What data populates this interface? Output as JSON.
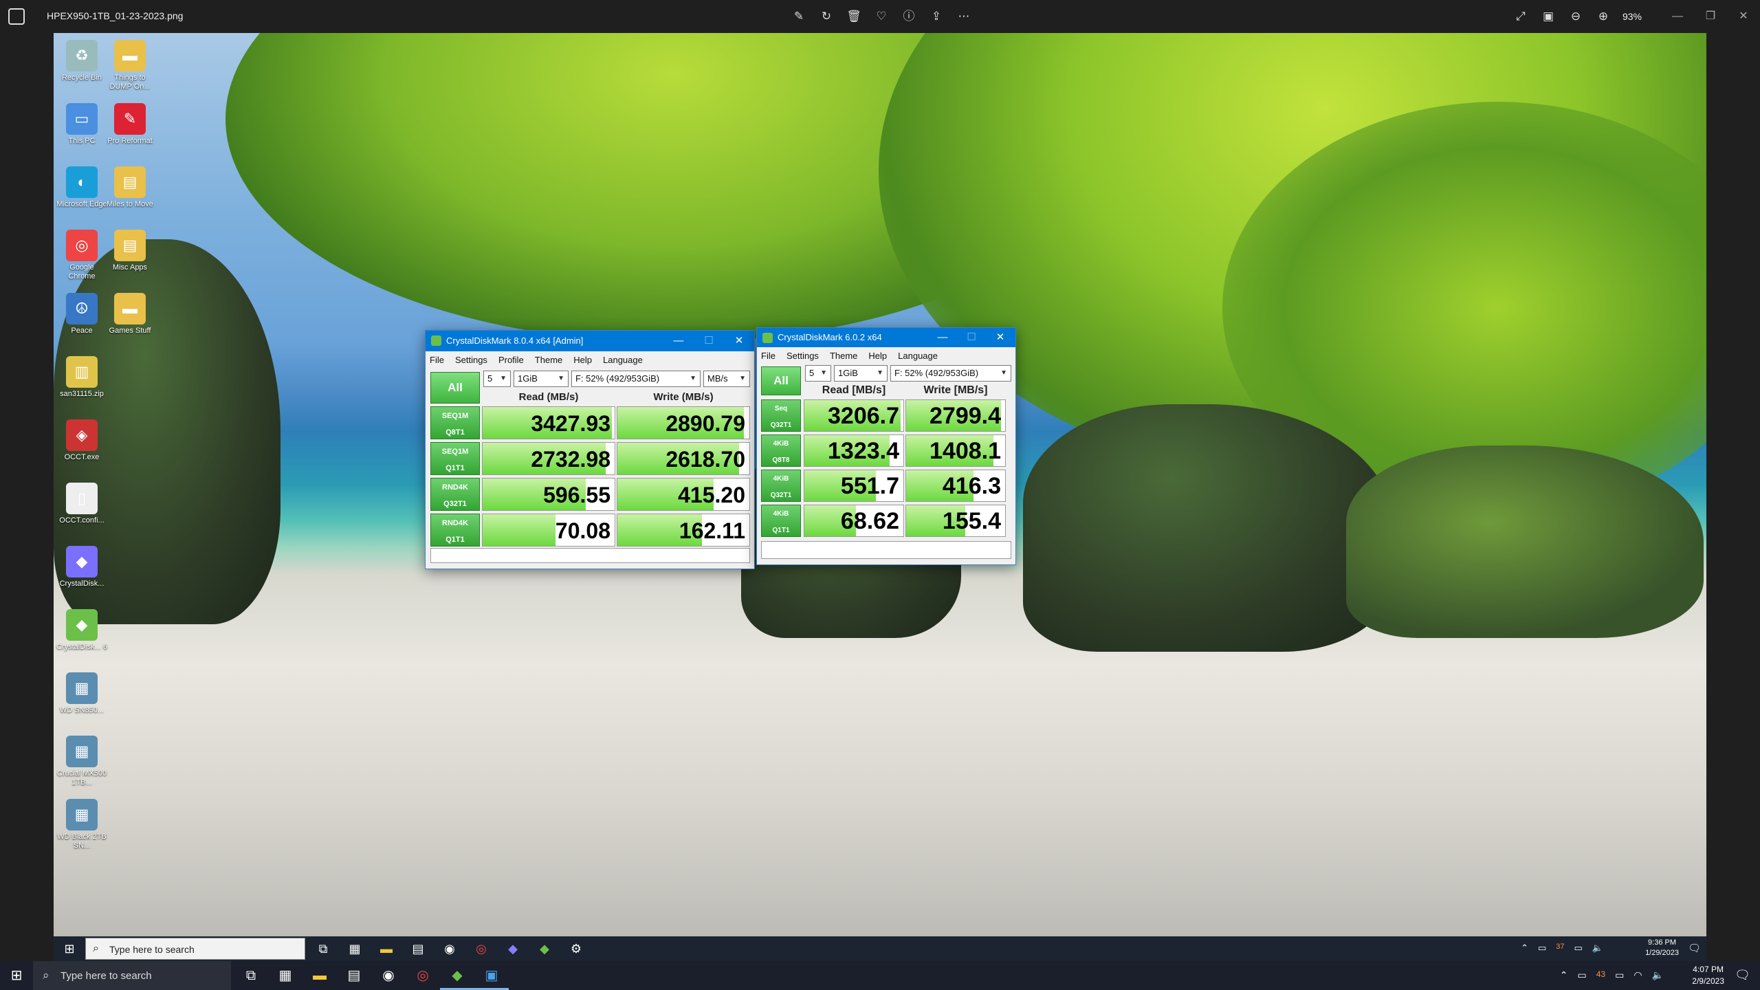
{
  "viewer": {
    "filename": "HPEX950-1TB_01-23-2023.png",
    "zoom": "93%"
  },
  "desktop_icons": [
    {
      "label": "Recycle Bin",
      "icon": "recycle-bin-icon"
    },
    {
      "label": "Things to DUMP On...",
      "icon": "folder-icon"
    },
    {
      "label": "This PC",
      "icon": "computer-icon"
    },
    {
      "label": "Pro Reformat",
      "icon": "pdf-icon"
    },
    {
      "label": "Microsoft Edge",
      "icon": "edge-icon"
    },
    {
      "label": "Miles to Move",
      "icon": "folder-doc-icon"
    },
    {
      "label": "Google Chrome",
      "icon": "chrome-icon"
    },
    {
      "label": "Misc Apps",
      "icon": "folder-doc-icon"
    },
    {
      "label": "Peace",
      "icon": "peace-icon"
    },
    {
      "label": "Games Stuff",
      "icon": "folder-icon"
    },
    {
      "label": "san31115.zip",
      "icon": "zip-icon"
    },
    {
      "label": "OCCT.exe",
      "icon": "occt-icon"
    },
    {
      "label": "OCCT.confi...",
      "icon": "file-icon"
    },
    {
      "label": "CrystalDisk...",
      "icon": "crystaldisk-icon"
    },
    {
      "label": "CrystalDisk... 6",
      "icon": "crystaldisk6-icon"
    },
    {
      "label": "WD SN850...",
      "icon": "image-icon"
    },
    {
      "label": "Crucial MX500 1TB...",
      "icon": "image-icon"
    },
    {
      "label": "WD Black 2TB SN...",
      "icon": "image-icon"
    }
  ],
  "inner_taskbar": {
    "search_placeholder": "Type here to search",
    "time": "9:36 PM",
    "date": "1/29/2023",
    "badge": "37"
  },
  "taskbar": {
    "search_placeholder": "Type here to search",
    "time": "4:07 PM",
    "date": "2/9/2023",
    "badge": "43"
  },
  "cdm8": {
    "title": "CrystalDiskMark 8.0.4 x64 [Admin]",
    "menu": [
      "File",
      "Settings",
      "Profile",
      "Theme",
      "Help",
      "Language"
    ],
    "count": "5",
    "size": "1GiB",
    "drive": "F: 52% (492/953GiB)",
    "unit": "MB/s",
    "all": "All",
    "read_header": "Read (MB/s)",
    "write_header": "Write (MB/s)",
    "rows": [
      {
        "label1": "SEQ1M",
        "label2": "Q8T1",
        "read": "3427.93",
        "write": "2890.79",
        "read_fill": 0.98,
        "write_fill": 0.96
      },
      {
        "label1": "SEQ1M",
        "label2": "Q1T1",
        "read": "2732.98",
        "write": "2618.70",
        "read_fill": 0.93,
        "write_fill": 0.92
      },
      {
        "label1": "RND4K",
        "label2": "Q32T1",
        "read": "596.55",
        "write": "415.20",
        "read_fill": 0.78,
        "write_fill": 0.73
      },
      {
        "label1": "RND4K",
        "label2": "Q1T1",
        "read": "70.08",
        "write": "162.11",
        "read_fill": 0.55,
        "write_fill": 0.64
      }
    ]
  },
  "cdm6": {
    "title": "CrystalDiskMark 6.0.2 x64",
    "menu": [
      "File",
      "Settings",
      "Theme",
      "Help",
      "Language"
    ],
    "count": "5",
    "size": "1GiB",
    "drive": "F: 52% (492/953GiB)",
    "all": "All",
    "read_header": "Read [MB/s]",
    "write_header": "Write [MB/s]",
    "rows": [
      {
        "label1": "Seq",
        "label2": "Q32T1",
        "read": "3206.7",
        "write": "2799.4",
        "read_fill": 0.97,
        "write_fill": 0.96
      },
      {
        "label1": "4KiB",
        "label2": "Q8T8",
        "read": "1323.4",
        "write": "1408.1",
        "read_fill": 0.86,
        "write_fill": 0.88
      },
      {
        "label1": "4KiB",
        "label2": "Q32T1",
        "read": "551.7",
        "write": "416.3",
        "read_fill": 0.72,
        "write_fill": 0.68
      },
      {
        "label1": "4KiB",
        "label2": "Q1T1",
        "read": "68.62",
        "write": "155.4",
        "read_fill": 0.52,
        "write_fill": 0.6
      }
    ]
  }
}
